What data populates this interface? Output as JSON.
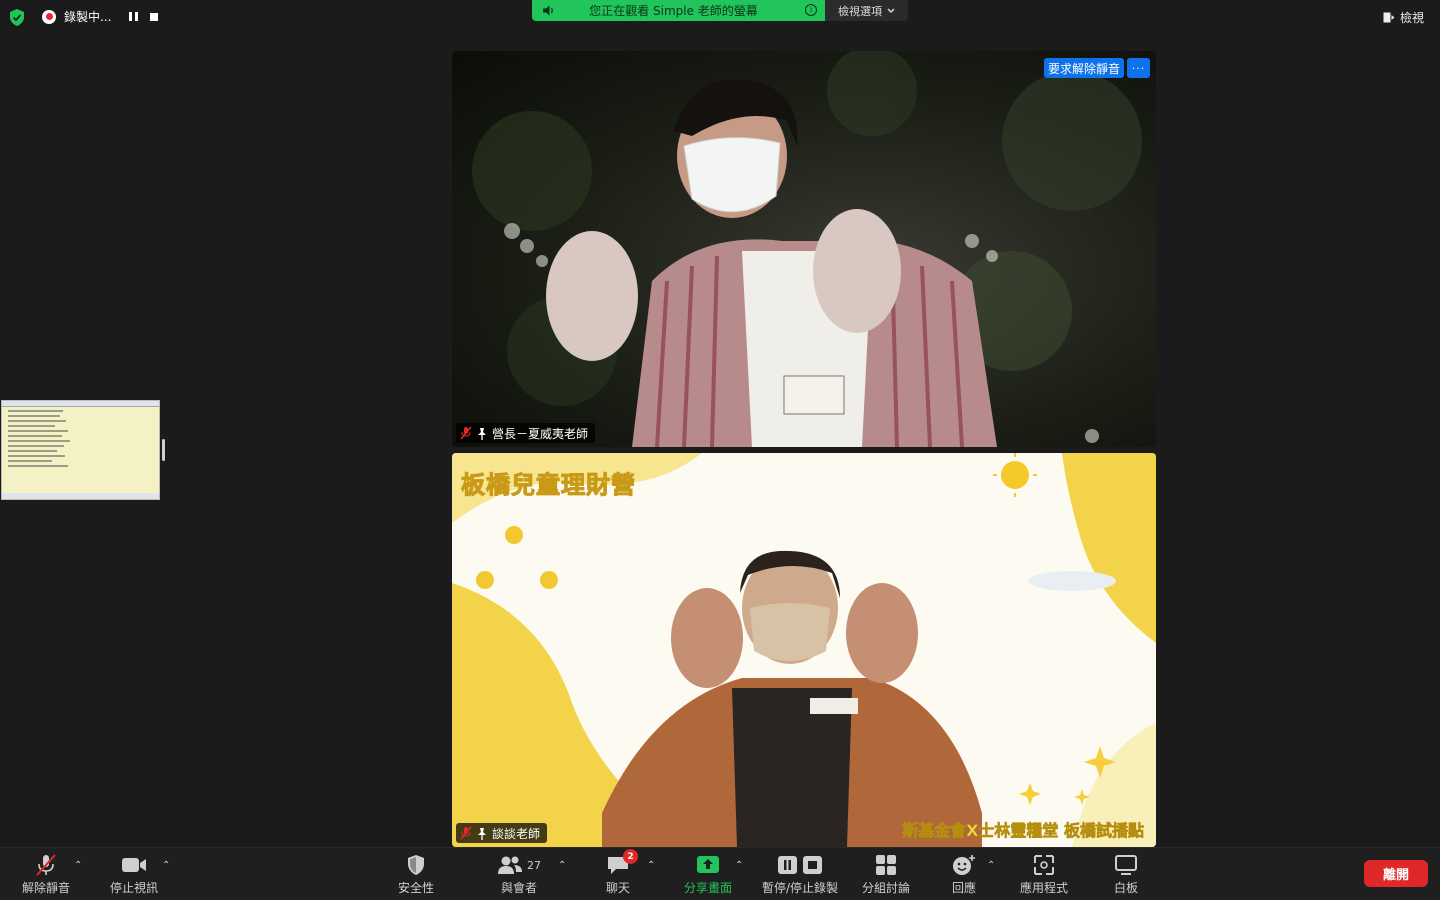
{
  "topbar": {
    "recording_label": "錄製中...",
    "share_banner_text": "您正在觀看 Simple 老師的螢幕",
    "view_options_label": "檢視選項",
    "view_label": "檢視"
  },
  "tiles": [
    {
      "name": "營長－夏威夷老師",
      "unmute_request_label": "要求解除靜音",
      "more_label": "···"
    },
    {
      "name": "談談老師",
      "background_title": "板橋兒童理財營",
      "background_subtitle": "斯基金會X士林靈糧堂 板橋試播點"
    }
  ],
  "toolbar": {
    "unmute": "解除靜音",
    "stop_video": "停止視訊",
    "security": "安全性",
    "participants": "與會者",
    "participants_count": "27",
    "chat": "聊天",
    "chat_badge": "2",
    "share_screen": "分享畫面",
    "pause_stop_recording": "暫停/停止錄製",
    "breakout_rooms": "分組討論",
    "reactions": "回應",
    "apps": "應用程式",
    "whiteboard": "白板",
    "leave": "離開"
  },
  "colors": {
    "accent_blue": "#0e72ed",
    "share_green": "#21c55b",
    "leave_red": "#e02828",
    "banner_yellow": "#f6d84f"
  }
}
